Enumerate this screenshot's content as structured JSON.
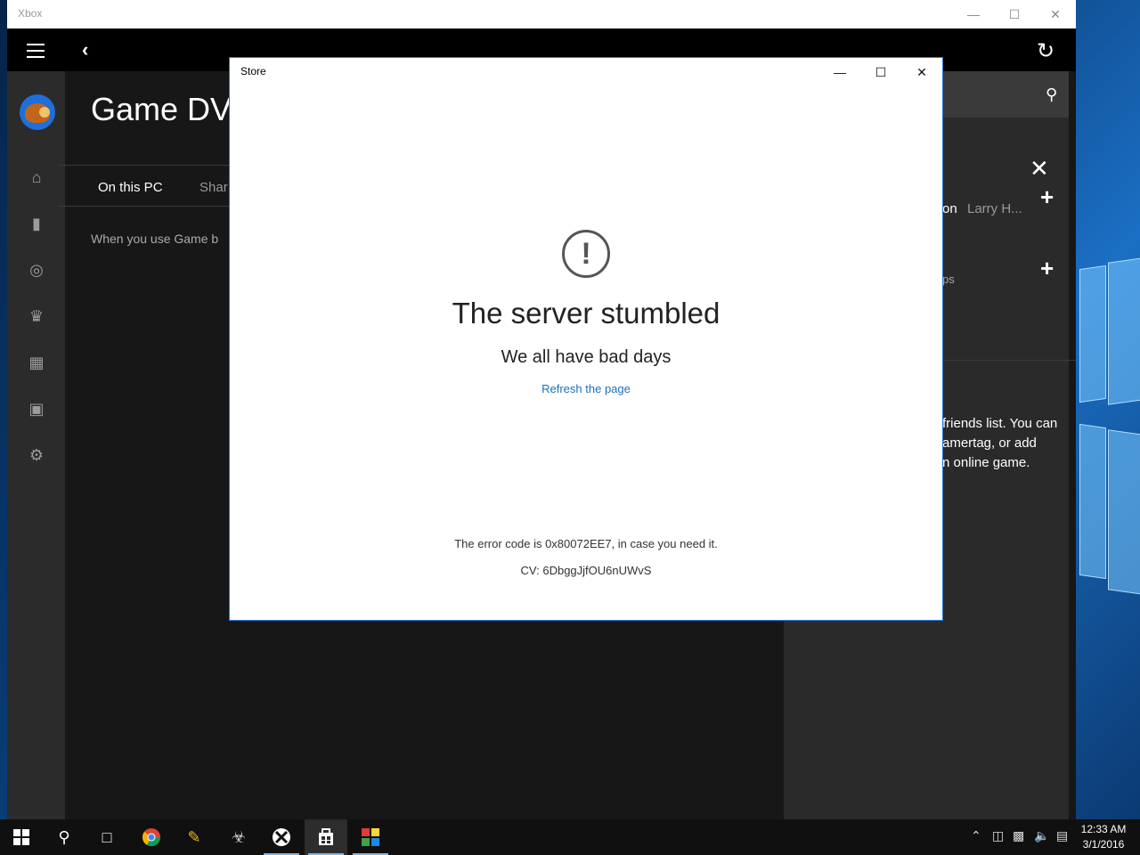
{
  "xbox_window": {
    "title": "Xbox",
    "page_title": "Game DV",
    "tabs": [
      {
        "label": "On this PC",
        "active": true
      },
      {
        "label": "Shar",
        "active": false
      }
    ],
    "description": "When you use Game b",
    "right_panel": {
      "friend_fragment": "on",
      "friend_name": "Larry H...",
      "item_fragment": "ps",
      "friends_text_line1": "friends list. You can",
      "friends_text_line2": "amertag, or add",
      "friends_text_line3": "n online game."
    }
  },
  "store_dialog": {
    "title": "Store",
    "icon": "exclamation-circle-icon",
    "headline": "The server stumbled",
    "subheadline": "We all have bad days",
    "link_label": "Refresh the page",
    "error_text": "The error code is 0x80072EE7, in case you need it.",
    "cv_text": "CV: 6DbggJjfOU6nUWvS",
    "link_color": "#1a6fbf"
  },
  "taskbar": {
    "time": "12:33 AM",
    "date": "3/1/2016"
  },
  "colors": {
    "accent": "#2b79d1",
    "xbox_bg": "#171717",
    "sidebar_bg": "#2b2b2b"
  }
}
